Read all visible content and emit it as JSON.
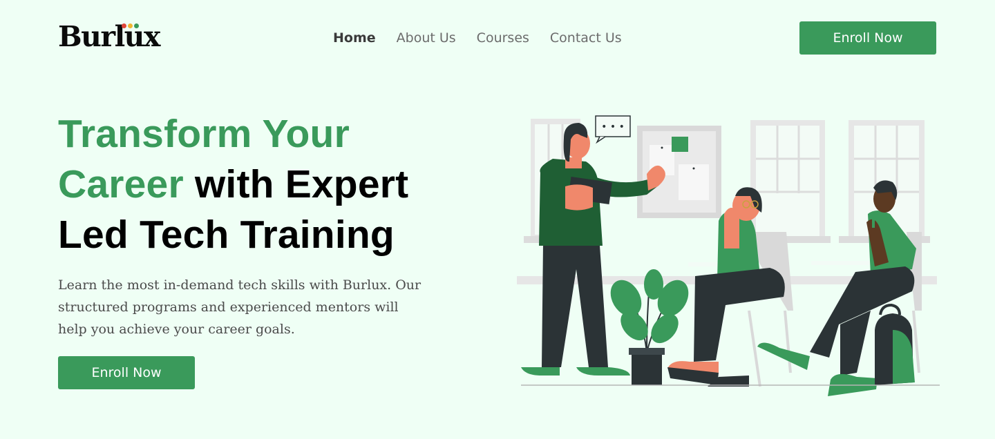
{
  "brand": {
    "name": "Burlux",
    "dot_colors": [
      "#e0463a",
      "#f2b632",
      "#3a9a5b"
    ]
  },
  "nav": {
    "items": [
      {
        "label": "Home",
        "active": true
      },
      {
        "label": "About Us",
        "active": false
      },
      {
        "label": "Courses",
        "active": false
      },
      {
        "label": "Contact Us",
        "active": false
      }
    ]
  },
  "header": {
    "cta_label": "Enroll Now"
  },
  "hero": {
    "title_green": "Transform Your Career",
    "title_rest": " with Expert Led Tech Training",
    "subtitle": "Learn the most in-demand tech skills with Burlux. Our structured programs and experienced mentors will help you achieve your career goals.",
    "cta_label": "Enroll Now"
  },
  "illustration": {
    "speech_bubble_text": "• • •"
  },
  "colors": {
    "accent": "#3a9a5b",
    "background": "#effff5",
    "dark": "#2b3336"
  }
}
